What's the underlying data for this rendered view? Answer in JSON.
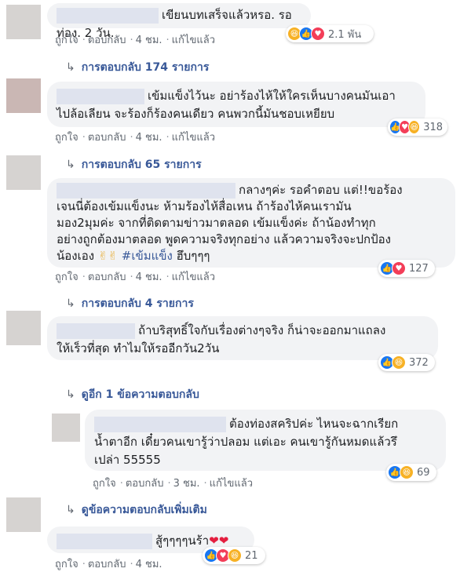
{
  "comments": [
    {
      "text": "เขียนบทเสร็จแล้วหรอ. รอท่อง. 2 วัน.",
      "actions": {
        "like": "ถูกใจ",
        "reply": "ตอบกลับ",
        "time": "4 ชม.",
        "edited": "แก้ไขแล้ว"
      },
      "reactions": {
        "icons": [
          "haha-icon",
          "like-icon",
          "love-icon"
        ],
        "count": "2.1 พัน"
      },
      "replies_label": "การตอบกลับ 174 รายการ"
    },
    {
      "lines": [
        "เข้มแข็งไว้นะ อย่าร้องไห้ให้ใครเห็นบางคนมันเอา",
        "ไปล้อเลียน จะร้องก็ร้องคนเดียว คนพวกนี้มันชอบเหยียบ"
      ],
      "actions": {
        "like": "ถูกใจ",
        "reply": "ตอบกลับ",
        "time": "4 ชม.",
        "edited": "แก้ไขแล้ว"
      },
      "reactions": {
        "icons": [
          "like-icon",
          "love-icon",
          "haha-icon"
        ],
        "count": "318"
      },
      "replies_label": "การตอบกลับ 65 รายการ"
    },
    {
      "lines": [
        "กลางๆค่ะ รอคำตอบ แต่!!ขอร้อง",
        "เจนนี่ต้องเข้มแข็งนะ ห้ามร้องไห้สื่อเหน ถ้าร้องไห้คนเรามัน",
        "มอง2มุมค่ะ จากที่ติดตามข่าวมาตลอด เข้มแข็งค่ะ ถ้าน้องทำทุก",
        "อย่างถูกต้องมาตลอด พูดความจริงทุกอย่าง แล้วความจริงจะปกป้อง",
        "น้องเอง"
      ],
      "emoji": "✌✌",
      "hashtag": "#เข้มแข็ง",
      "tail": "ฮึบๆๆๆ",
      "actions": {
        "like": "ถูกใจ",
        "reply": "ตอบกลับ",
        "time": "4 ชม.",
        "edited": "แก้ไขแล้ว"
      },
      "reactions": {
        "icons": [
          "like-icon",
          "love-icon"
        ],
        "count": "127"
      },
      "replies_label": "การตอบกลับ 4 รายการ"
    },
    {
      "lines": [
        "ถ้าบริสุทธิ์ใจกับเรื่องต่างๆจริง ก็น่าจะออกมาแถลง",
        "ให้เร็วที่สุด ทำไมให้รออีกวัน2วัน"
      ],
      "reactions": {
        "icons": [
          "like-icon",
          "haha-icon"
        ],
        "count": "372"
      },
      "more_replies": "ดูอีก 1 ข้อความตอบกลับ"
    },
    {
      "lines": [
        "ต้องท่องสคริปค่ะ ไหนจะฉากเรียก",
        "น้ำตาอีก เดี๋ยวคนเขารู้ว่าปลอม แต่เอะ คนเขารู้กันหมดแล้วรึ",
        "เปล่า 55555"
      ],
      "actions": {
        "like": "ถูกใจ",
        "reply": "ตอบกลับ",
        "time": "3 ชม.",
        "edited": "แก้ไขแล้ว"
      },
      "reactions": {
        "icons": [
          "like-icon",
          "haha-icon"
        ],
        "count": "69"
      }
    },
    {
      "view_more": "ดูข้อความตอบกลับเพิ่มเติม"
    },
    {
      "text": "สู้ๆๆๆๆนร้า",
      "hearts": "❤❤",
      "actions": {
        "like": "ถูกใจ",
        "reply": "ตอบกลับ",
        "time": "4 ชม."
      },
      "reactions": {
        "icons": [
          "like-icon",
          "love-icon",
          "haha-icon"
        ],
        "count": "21"
      }
    }
  ],
  "colors": {
    "link": "#385898",
    "bubble": "#f2f3f5",
    "like": "#1877f2",
    "love": "#f33e58",
    "haha": "#f7b125"
  }
}
